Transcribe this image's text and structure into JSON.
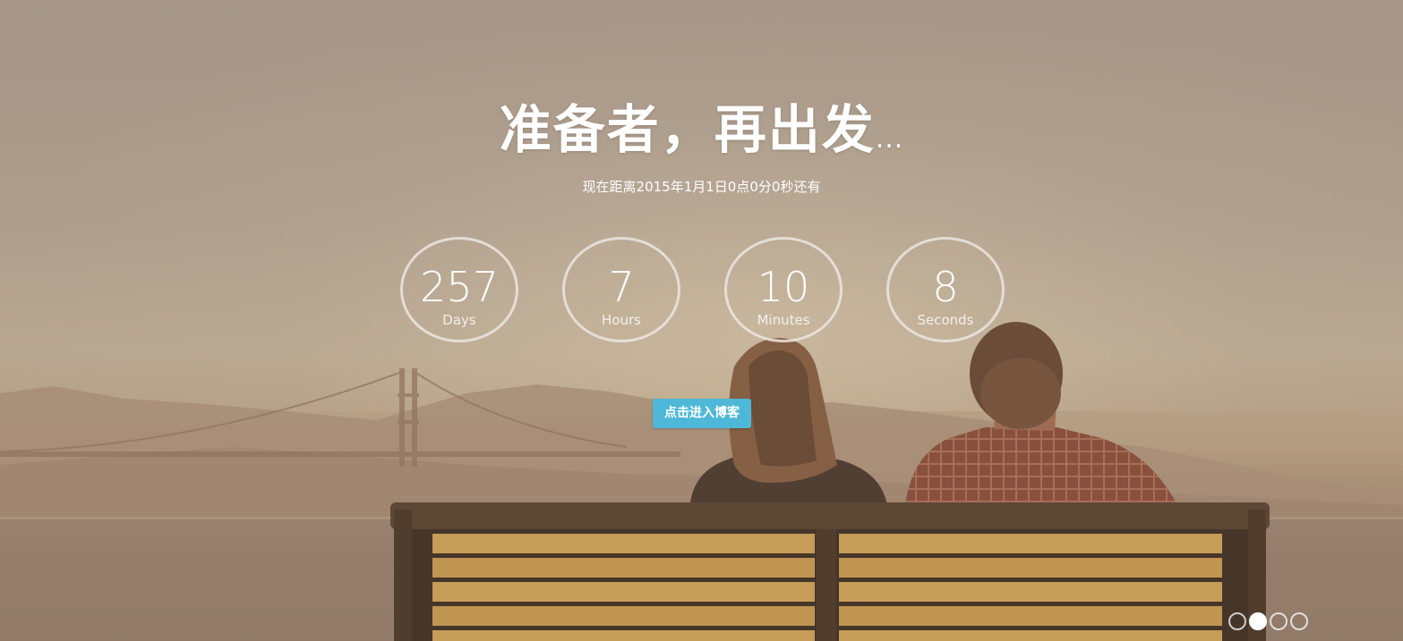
{
  "hero": {
    "title": "准备者，再出发",
    "title_suffix": "...",
    "subtitle": "现在距离2015年1月1日0点0分0秒还有"
  },
  "countdown": [
    {
      "value": "257",
      "unit": "Days"
    },
    {
      "value": "7",
      "unit": "Hours"
    },
    {
      "value": "10",
      "unit": "Minutes"
    },
    {
      "value": "8",
      "unit": "Seconds"
    }
  ],
  "cta": {
    "label": "点击进入博客"
  },
  "carousel": {
    "count": 4,
    "active_index": 1
  },
  "colors": {
    "button": "#4fb8d8",
    "text": "#ffffff"
  }
}
